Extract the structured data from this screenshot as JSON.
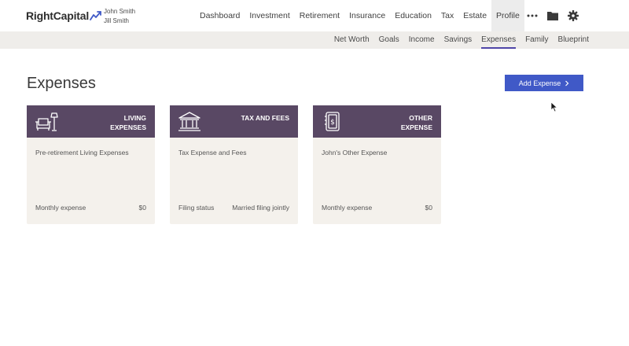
{
  "brand": {
    "logo_text": "RightCapital",
    "accent": "#4059c7"
  },
  "clients": {
    "primary": "John Smith",
    "spouse": "Jill Smith"
  },
  "main_nav": {
    "dashboard": "Dashboard",
    "investment": "Investment",
    "retirement": "Retirement",
    "insurance": "Insurance",
    "education": "Education",
    "tax": "Tax",
    "estate": "Estate",
    "profile": "Profile"
  },
  "top_icons": [
    "more-icon",
    "folder-icon",
    "gear-icon"
  ],
  "sub_nav": {
    "net_worth": "Net Worth",
    "goals": "Goals",
    "income": "Income",
    "savings": "Savings",
    "expenses": "Expenses",
    "family": "Family",
    "blueprint": "Blueprint"
  },
  "page": {
    "title": "Expenses",
    "add_button_label": "Add Expense",
    "add_button_icon": "chevron-right-icon"
  },
  "cards": [
    {
      "header_line1": "LIVING",
      "header_line2": "EXPENSES",
      "icon": "couch-lamp-icon",
      "description": "Pre-retirement Living Expenses",
      "footer_label": "Monthly expense",
      "footer_value": "$0"
    },
    {
      "header_line1": "TAX AND FEES",
      "header_line2": "",
      "icon": "bank-building-icon",
      "description": "Tax Expense and Fees",
      "footer_label": "Filing status",
      "footer_value": "Married filing jointly"
    },
    {
      "header_line1": "OTHER",
      "header_line2": "EXPENSE",
      "icon": "receipt-dollar-icon",
      "description": "John's Other Expense",
      "footer_label": "Monthly expense",
      "footer_value": "$0"
    }
  ],
  "colors": {
    "card_header": "#594864",
    "card_body": "#f4f1ec",
    "subnav_bg": "#efedea",
    "active_underline": "#4f46a8"
  }
}
